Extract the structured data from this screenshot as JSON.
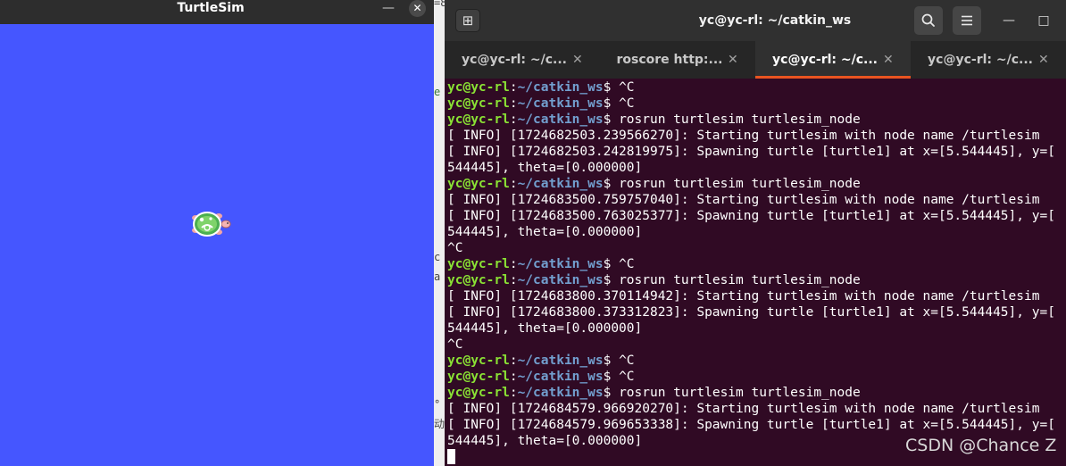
{
  "turtlesim": {
    "title": "TurtleSim",
    "minimize_glyph": "—",
    "close_glyph": "✕",
    "background_color": "#4556ff"
  },
  "terminal": {
    "title": "yc@yc-rl: ~/catkin_ws",
    "new_tab_glyph": "⊞",
    "minimize_glyph": "—",
    "maximize_glyph": "□",
    "tabs": [
      {
        "label": "yc@yc-rl: ~/c...",
        "active": false
      },
      {
        "label": "roscore http:...",
        "active": false
      },
      {
        "label": "yc@yc-rl: ~/c...",
        "active": true
      },
      {
        "label": "yc@yc-rl: ~/c...",
        "active": false
      }
    ],
    "tab_close_glyph": "✕",
    "prompt_user": "yc@yc-rl",
    "prompt_path": "~/catkin_ws",
    "lines": [
      {
        "prompt": true,
        "cmd": "^C"
      },
      {
        "prompt": true,
        "cmd": "^C"
      },
      {
        "prompt": true,
        "cmd": "rosrun turtlesim turtlesim_node"
      },
      {
        "text": "[ INFO] [1724682503.239566270]: Starting turtlesim with node name /turtlesim"
      },
      {
        "text": "[ INFO] [1724682503.242819975]: Spawning turtle [turtle1] at x=[5.544445], y=["
      },
      {
        "text": "544445], theta=[0.000000]"
      },
      {
        "prompt": true,
        "cmd": "rosrun turtlesim turtlesim_node"
      },
      {
        "text": "[ INFO] [1724683500.759757040]: Starting turtlesim with node name /turtlesim"
      },
      {
        "text": "[ INFO] [1724683500.763025377]: Spawning turtle [turtle1] at x=[5.544445], y=["
      },
      {
        "text": "544445], theta=[0.000000]"
      },
      {
        "text": "^C"
      },
      {
        "prompt": true,
        "cmd": "^C"
      },
      {
        "prompt": true,
        "cmd": "rosrun turtlesim turtlesim_node"
      },
      {
        "text": "[ INFO] [1724683800.370114942]: Starting turtlesim with node name /turtlesim"
      },
      {
        "text": "[ INFO] [1724683800.373312823]: Spawning turtle [turtle1] at x=[5.544445], y=["
      },
      {
        "text": "544445], theta=[0.000000]"
      },
      {
        "text": "^C"
      },
      {
        "prompt": true,
        "cmd": "^C"
      },
      {
        "prompt": true,
        "cmd": "^C"
      },
      {
        "prompt": true,
        "cmd": "rosrun turtlesim turtlesim_node"
      },
      {
        "text": "[ INFO] [1724684579.966920270]: Starting turtlesim with node name /turtlesim"
      },
      {
        "text": "[ INFO] [1724684579.969653338]: Spawning turtle [turtle1] at x=[5.544445], y=["
      },
      {
        "text": "544445], theta=[0.000000]"
      },
      {
        "cursor": true
      }
    ]
  },
  "background_fragments": [
    "=8",
    "e",
    "c",
    "a",
    "°",
    "动"
  ],
  "watermark": "CSDN @Chance Z"
}
